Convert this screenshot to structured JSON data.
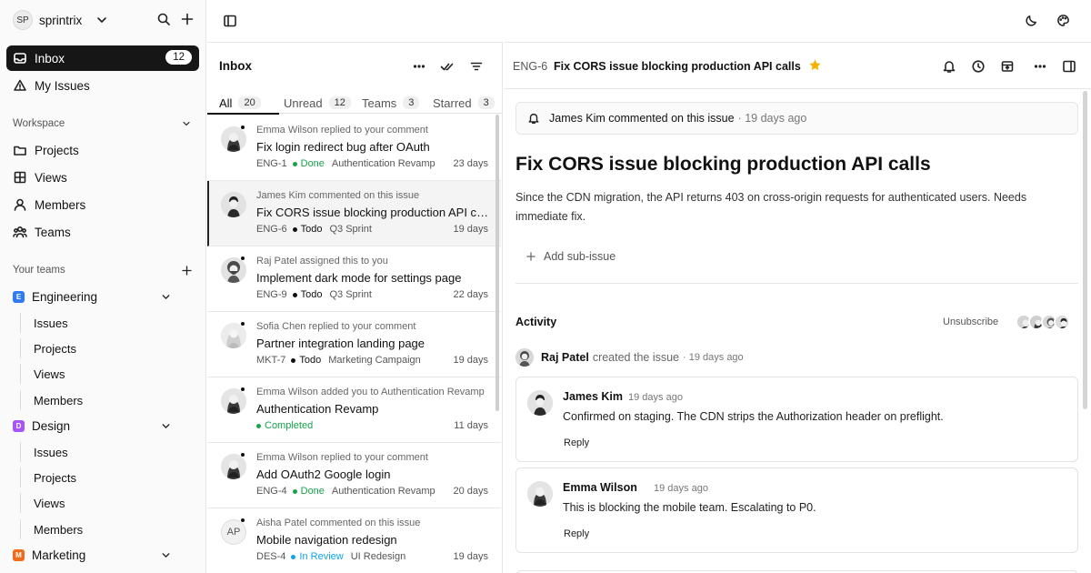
{
  "workspace": {
    "initials": "SP",
    "name": "sprintrix"
  },
  "sidebar": {
    "nav": [
      {
        "label": "Inbox",
        "count": "12",
        "active": true
      },
      {
        "label": "My Issues"
      }
    ],
    "workspace_header": "Workspace",
    "workspace_items": [
      "Projects",
      "Views",
      "Members",
      "Teams"
    ],
    "teams_header": "Your teams",
    "teams": [
      {
        "letter": "E",
        "name": "Engineering",
        "color": "#2f7bf5",
        "children": [
          "Issues",
          "Projects",
          "Views",
          "Members"
        ]
      },
      {
        "letter": "D",
        "name": "Design",
        "color": "#a855f7",
        "children": [
          "Issues",
          "Projects",
          "Views",
          "Members"
        ]
      },
      {
        "letter": "M",
        "name": "Marketing",
        "color": "#f26a1b",
        "children": []
      }
    ]
  },
  "inbox": {
    "title": "Inbox",
    "tabs": [
      {
        "label": "All",
        "count": "20"
      },
      {
        "label": "Unread",
        "count": "12"
      },
      {
        "label": "Teams",
        "count": "3"
      },
      {
        "label": "Starred",
        "count": "3"
      }
    ],
    "items": [
      {
        "event": "Emma Wilson replied to your comment",
        "title": "Fix login redirect bug after OAuth",
        "id": "ENG-1",
        "status": "Done",
        "status_color": "#16a34a",
        "project": "Authentication Revamp",
        "time": "23 days",
        "unread": true,
        "avatar": "emma"
      },
      {
        "event": "James Kim commented on this issue",
        "title": "Fix CORS issue blocking production API calls",
        "id": "ENG-6",
        "status": "Todo",
        "status_color": "#111111",
        "project": "Q3 Sprint",
        "time": "19 days",
        "unread": false,
        "selected": true,
        "avatar": "james"
      },
      {
        "event": "Raj Patel assigned this to you",
        "title": "Implement dark mode for settings page",
        "id": "ENG-9",
        "status": "Todo",
        "status_color": "#111111",
        "project": "Q3 Sprint",
        "time": "22 days",
        "unread": true,
        "avatar": "raj"
      },
      {
        "event": "Sofia Chen replied to your comment",
        "title": "Partner integration landing page",
        "id": "MKT-7",
        "status": "Todo",
        "status_color": "#111111",
        "project": "Marketing Campaign",
        "time": "19 days",
        "unread": true,
        "avatar": "sofia"
      },
      {
        "event": "Emma Wilson added you to Authentication Revamp",
        "title": "Authentication Revamp",
        "id": "",
        "status": "Completed",
        "status_color": "#16a34a",
        "project": "",
        "time": "11 days",
        "unread": true,
        "avatar": "emma"
      },
      {
        "event": "Emma Wilson replied to your comment",
        "title": "Add OAuth2 Google login",
        "id": "ENG-4",
        "status": "Done",
        "status_color": "#16a34a",
        "project": "Authentication Revamp",
        "time": "20 days",
        "unread": true,
        "avatar": "emma"
      },
      {
        "event": "Aisha Patel commented on this issue",
        "title": "Mobile navigation redesign",
        "id": "DES-4",
        "status": "In Review",
        "status_color": "#0ea5e9",
        "project": "UI Redesign",
        "time": "19 days",
        "unread": true,
        "avatar": "AP"
      }
    ]
  },
  "detail": {
    "id": "ENG-6",
    "title": "Fix CORS issue blocking production API calls",
    "banner": {
      "who": "James Kim commented on this issue",
      "ago": "· 19 days ago"
    },
    "heading": "Fix CORS issue blocking production API calls",
    "description": "Since the CDN migration, the API returns 403 on cross-origin requests for authenticated users. Needs immediate fix.",
    "add_subissue": "Add sub-issue",
    "activity_label": "Activity",
    "unsubscribe": "Unsubscribe",
    "created": {
      "name": "Raj Patel",
      "text": "created the issue",
      "ago": "· 19 days ago"
    },
    "comments": [
      {
        "name": "James Kim",
        "ago": "19 days ago",
        "body": "Confirmed on staging. The CDN strips the Authorization header on preflight.",
        "reply": "Reply"
      },
      {
        "name": "Emma Wilson",
        "ago": "19 days ago",
        "body": "This is blocking the mobile team. Escalating to P0.",
        "reply": "Reply"
      }
    ]
  },
  "colors": {
    "accent_dark": "#161616",
    "star": "#f5b301",
    "done": "#16a34a",
    "review": "#0ea5e9"
  }
}
